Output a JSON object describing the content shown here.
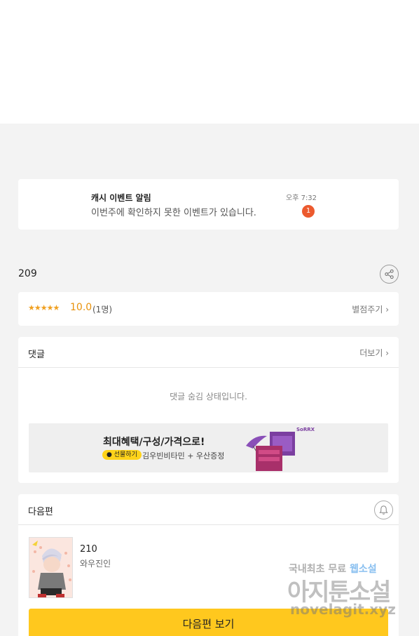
{
  "notice": {
    "title": "캐시 이벤트 알림",
    "message": "이번주에 확인하지 못한 이벤트가 있습니다.",
    "time": "오후 7:32",
    "badge": "1"
  },
  "episode": {
    "title": "209",
    "share_icon": "share-icon"
  },
  "rating": {
    "stars": "★★★★★",
    "score": "10.0",
    "count": "(1명)",
    "rate_button": "별점주기 ›"
  },
  "comments": {
    "title": "댓글",
    "more": "더보기 ›",
    "hidden_message": "댓글 숨김 상태입니다."
  },
  "ad": {
    "headline": "최대혜택/구성/가격으로!",
    "gift_label": "선물하기",
    "subtitle": "김우빈비타민 + 우산증정",
    "brand": "SoRRX"
  },
  "next_episode": {
    "title": "다음편",
    "number": "210",
    "author": "와우진인",
    "view_button": "다음편 보기"
  },
  "watermark": {
    "line1_prefix": "국내최초 무료 ",
    "line1_accent": "웹소설",
    "line2": "아지툰소설",
    "line3": "novelagit.xyz"
  },
  "colors": {
    "accent": "#ffc81e",
    "badge": "#ec5a2e",
    "star": "#f0a020"
  }
}
